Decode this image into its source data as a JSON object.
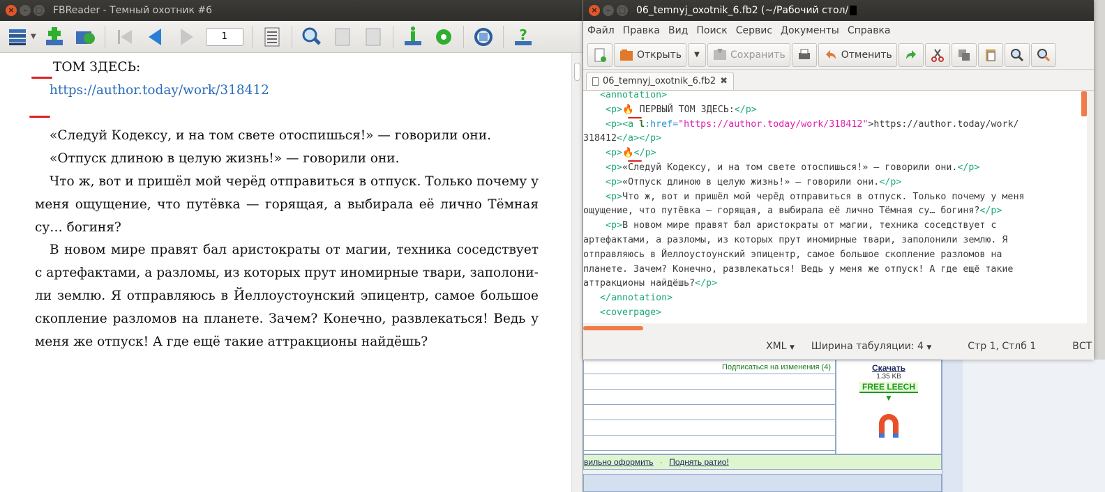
{
  "reader_window": {
    "title": "FBReader - Темный охотник #6",
    "page_number": "1",
    "toolbar_icons": [
      "library-icon",
      "add-book-icon",
      "network-library-icon",
      "first-page-icon",
      "back-icon",
      "forward-icon",
      "toc-icon",
      "search-icon",
      "previous-search-icon",
      "next-search-icon",
      "book-info-icon",
      "preferences-icon",
      "rotate-icon",
      "help-icon"
    ],
    "lines": [
      "ТОМ ЗДЕСЬ:",
      "https://author.today/work/318412",
      "«Следуй Кодексу, и на том свете отоспишься!» — говорили они.",
      "«Отпуск длиною в целую жизнь!» — говорили они.",
      "Что ж, вот и пришёл мой черёд отправиться в отпуск. Только почему у",
      "меня ощущение, что путёвка — горящая, а выбирала её лично Тёмная",
      "су… богиня?",
      "В новом мире правят бал аристократы от магии, техника соседствует",
      "с артефактами, а разломы, из которых прут иномирные твари, заполони-",
      "ли землю. Я отправляюсь в Йеллоустоунский эпицентр, самое большое",
      "скопление разломов на планете. Зачем? Конечно, развлекаться! Ведь у",
      "меня же отпуск! А где ещё такие аттракционы найдёшь?"
    ]
  },
  "editor_window": {
    "title": "06_temnyj_oxotnik_6.fb2 (~/Рабочий стол/",
    "menu": [
      "Файл",
      "Правка",
      "Вид",
      "Поиск",
      "Сервис",
      "Документы",
      "Справка"
    ],
    "toolbar": {
      "new": "",
      "open": "Открыть",
      "save": "Сохранить",
      "undo": "Отменить"
    },
    "tab_label": "06_temnyj_oxotnik_6.fb2",
    "status": {
      "syntax": "XML",
      "tab_width": "Ширина табуляции:  4",
      "position": "Стр 1, Стлб 1",
      "mode": "ВСТ"
    },
    "code": {
      "l1": "<annotation>",
      "l2_open": "<p>",
      "l2_text": "🔥 ПЕРВЫЙ ТОМ ЗДЕСЬ:",
      "l2_close": "</p>",
      "l3_tag": "<a ",
      "l3_ns": "l",
      "l3_attr": ":href=",
      "l3_val": "\"https://author.today/work/318412\"",
      "l3_text": ">https://author.today/work/",
      "l4_text": "318412",
      "l4_tag": "</a></p>",
      "l5_text": "🔥",
      "l6_text": "«Следуй Кодексу, и на том свете отоспишься!» — говорили они.",
      "l7_text": "«Отпуск длиною в целую жизнь!» — говорили они.",
      "l8_text": "Что ж, вот и пришёл мой черёд отправиться в отпуск. Только почему у меня",
      "l9_text": "ощущение, что путёвка — горящая, а выбирала её лично Тёмная су… богиня?",
      "l10_text": "В новом мире правят бал аристократы от магии, техника соседствует с",
      "l11_text": "артефактами, а разломы, из которых прут иномирные твари, заполонили землю. Я",
      "l12_text": "отправляюсь в Йеллоустоунский эпицентр, самое большое скопление разломов на",
      "l13_text": "планете. Зачем? Конечно, развлекаться! Ведь у меня же отпуск! А где ещё такие",
      "l14_text": "аттракционы найдёшь?",
      "l15": "</annotation>",
      "l16": "<coverpage>",
      "p_open": "<p>",
      "p_close": "</p>"
    }
  },
  "web_page": {
    "subscribe": "Подписаться на изменения (4)",
    "download": "Скачать",
    "size": "1.35 KB",
    "free_leech": "FREE LEECH",
    "bottom_link1": "вильно оформить",
    "bottom_sep": "·",
    "bottom_link2": "Поднять ратио!"
  }
}
